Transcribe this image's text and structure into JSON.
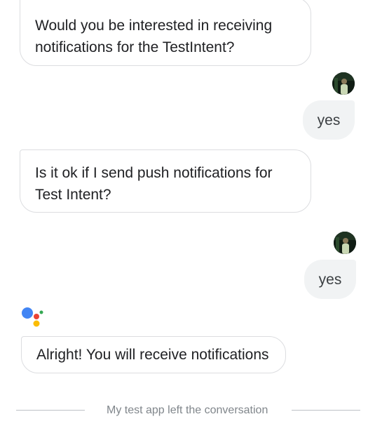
{
  "conversation": {
    "messages": [
      {
        "sender": "assistant",
        "text": "Would you be interested in receiving notifications for the TestIntent?"
      },
      {
        "sender": "user",
        "text": "yes",
        "avatar_icon": "user-avatar-photo"
      },
      {
        "sender": "assistant",
        "text": "Is it ok if I send push notifications for Test Intent?"
      },
      {
        "sender": "user",
        "text": "yes",
        "avatar_icon": "user-avatar-photo"
      },
      {
        "sender": "assistant",
        "text": "Alright! You will receive notifications",
        "logo_icon": "google-assistant-dots"
      }
    ],
    "system_message": "My test app left the conversation"
  },
  "colors": {
    "assistant_blue": "#4285f4",
    "assistant_red": "#ea4335",
    "assistant_yellow": "#fbbc04",
    "assistant_green": "#34a853",
    "user_bubble": "#f1f3f4",
    "assistant_border": "#dcdde0"
  }
}
